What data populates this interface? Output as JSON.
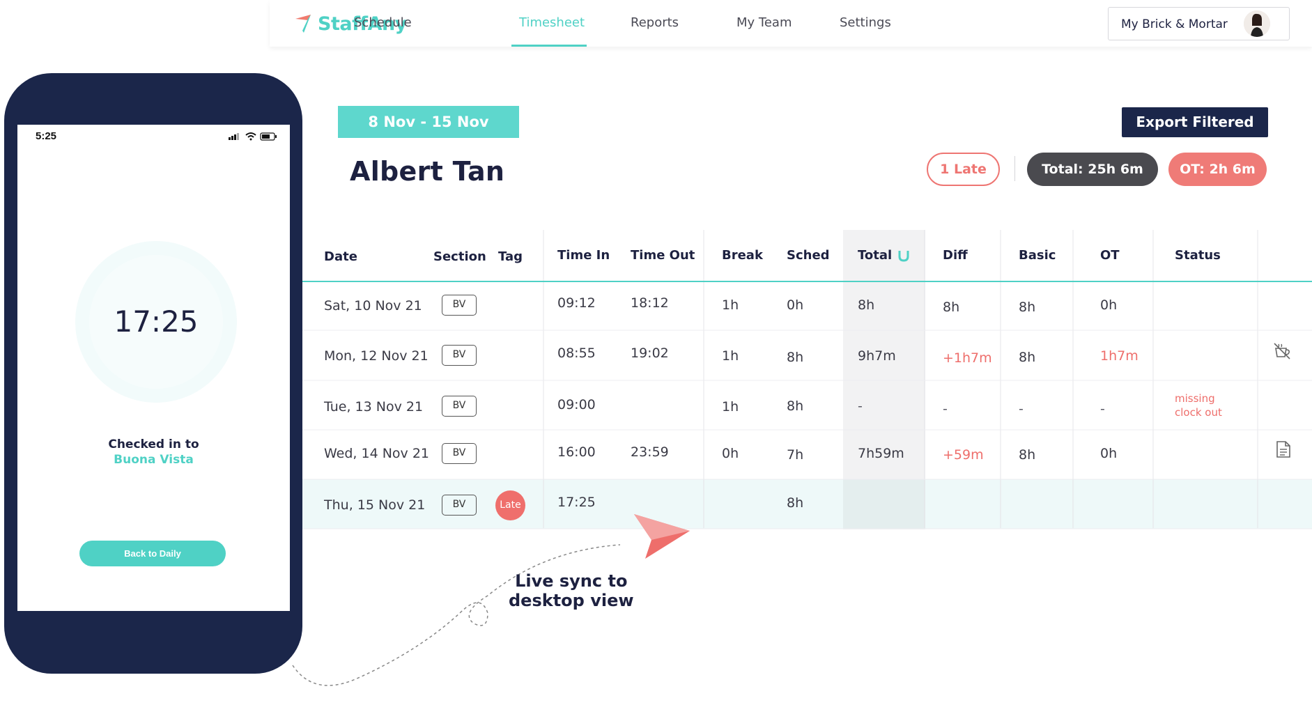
{
  "nav": {
    "brand": "StaffAny",
    "items": [
      {
        "label": "Schedule"
      },
      {
        "label": "Timesheet",
        "active": true
      },
      {
        "label": "Reports"
      },
      {
        "label": "My Team"
      },
      {
        "label": "Settings"
      }
    ],
    "org_label": "My Brick & Mortar",
    "accent_color": "#4fd1c5"
  },
  "phone": {
    "status_time": "5:25",
    "clock_time": "17:25",
    "checked_label": "Checked in to",
    "checked_place": "Buona Vista",
    "back_button": "Back to Daily",
    "frame_color": "#1b264a"
  },
  "header": {
    "date_range": "8 Nov - 15 Nov",
    "employee_name": "Albert Tan",
    "export_button": "Export Filtered",
    "late_pill": "1 Late",
    "total_pill": "Total: 25h 6m",
    "ot_pill": "OT: 2h 6m"
  },
  "table": {
    "columns": [
      "Date",
      "Section",
      "Tag",
      "Time In",
      "Time Out",
      "Break",
      "Sched",
      "Total",
      "Diff",
      "Basic",
      "OT",
      "Status"
    ],
    "rows": [
      {
        "date": "Sat, 10 Nov 21",
        "section": "BV",
        "tag": "",
        "time_in": "09:12",
        "time_out": "18:12",
        "break": "1h",
        "sched": "0h",
        "total": "8h",
        "diff": "8h",
        "basic": "8h",
        "ot": "0h",
        "status": "",
        "icon": ""
      },
      {
        "date": "Mon, 12 Nov 21",
        "section": "BV",
        "tag": "",
        "time_in": "08:55",
        "time_out": "19:02",
        "break": "1h",
        "sched": "8h",
        "total": "9h7m",
        "diff": "+1h7m",
        "basic": "8h",
        "ot": "1h7m",
        "status": "",
        "icon": "no-break-icon"
      },
      {
        "date": "Tue, 13 Nov 21",
        "section": "BV",
        "tag": "",
        "time_in": "09:00",
        "time_out": "",
        "break": "1h",
        "sched": "8h",
        "total": "-",
        "diff": "-",
        "basic": "-",
        "ot": "-",
        "status_line1": "missing",
        "status_line2": "clock out",
        "icon": ""
      },
      {
        "date": "Wed, 14 Nov 21",
        "section": "BV",
        "tag": "",
        "time_in": "16:00",
        "time_out": "23:59",
        "break": "0h",
        "sched": "7h",
        "total": "7h59m",
        "diff": "+59m",
        "basic": "8h",
        "ot": "0h",
        "status": "",
        "icon": "document-icon"
      },
      {
        "date": "Thu, 15 Nov 21",
        "section": "BV",
        "tag": "Late",
        "time_in": "17:25",
        "time_out": "",
        "break": "",
        "sched": "8h",
        "total": "",
        "diff": "",
        "basic": "",
        "ot": "",
        "status": "",
        "icon": ""
      }
    ]
  },
  "annotation": {
    "line1": "Live sync to",
    "line2": "desktop view"
  },
  "colors": {
    "teal": "#4fd1c5",
    "navy": "#1b264a",
    "red": "#ee6e6b",
    "dark_grey": "#4a4a4f"
  }
}
